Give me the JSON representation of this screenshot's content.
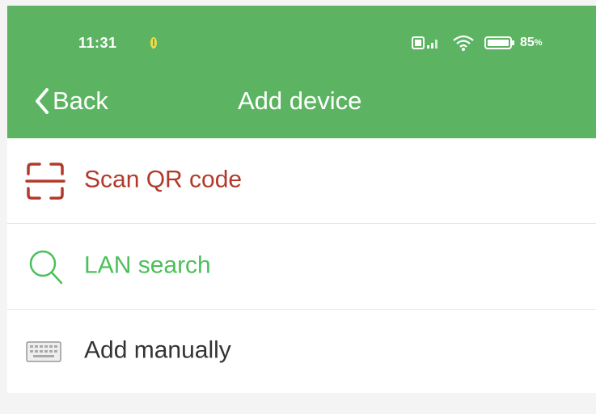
{
  "status_bar": {
    "time": "11:31",
    "battery": "85"
  },
  "nav": {
    "back_label": "Back",
    "title": "Add device"
  },
  "menu": {
    "items": [
      {
        "label": "Scan QR code",
        "color": "#b33a2b",
        "icon": "qr-scan-icon"
      },
      {
        "label": "LAN search",
        "color": "#4cbf5a",
        "icon": "search-icon"
      },
      {
        "label": "Add manually",
        "color": "#333333",
        "icon": "keyboard-icon"
      }
    ]
  },
  "colors": {
    "header": "#5cb462",
    "background": "#f4f4f4"
  }
}
